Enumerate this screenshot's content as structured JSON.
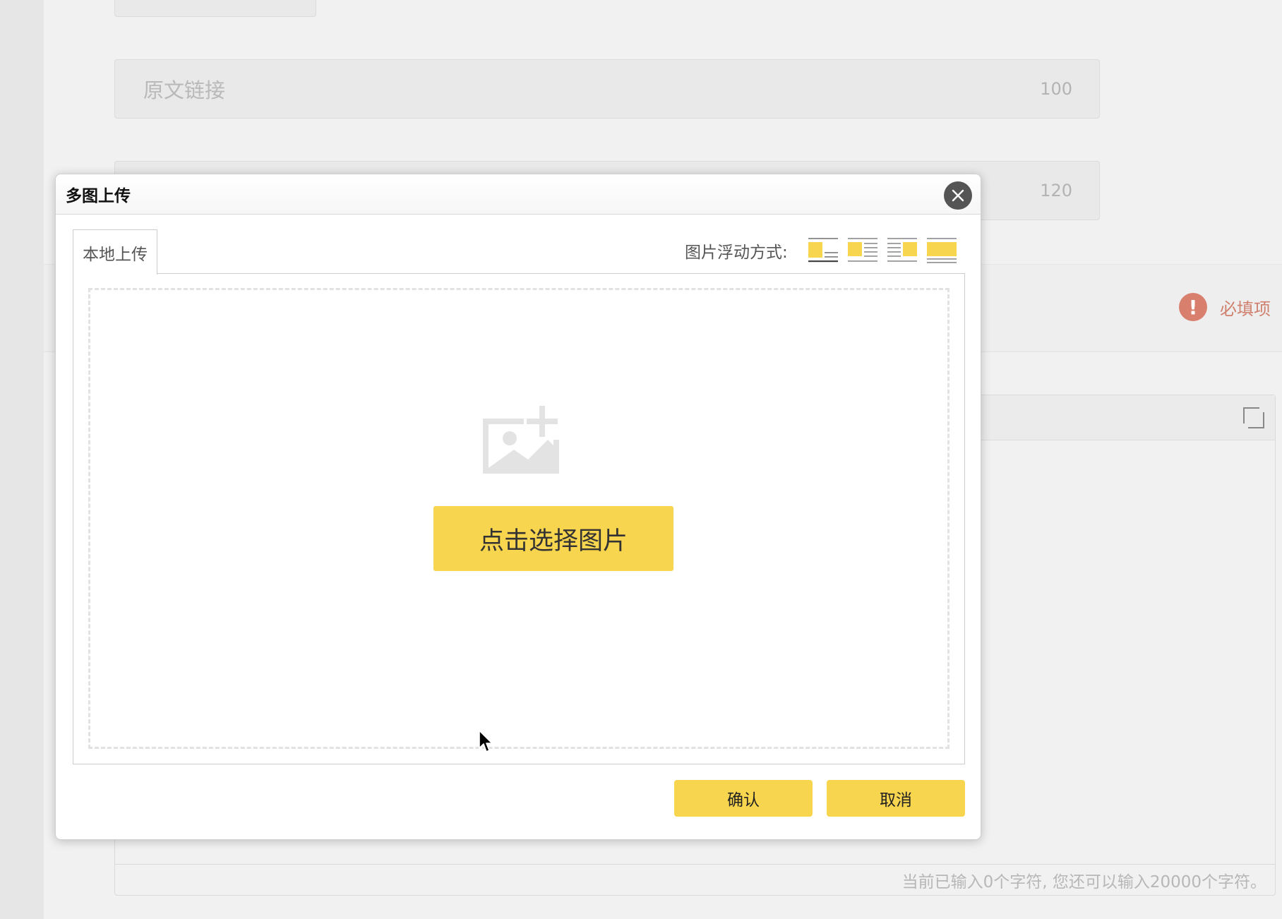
{
  "background": {
    "link_field": {
      "placeholder": "原文链接",
      "counter": "100"
    },
    "second_field": {
      "counter": "120"
    },
    "required_label": "必填项",
    "editor_status": "当前已输入0个字符, 您还可以输入20000个字符。"
  },
  "dialog": {
    "title": "多图上传",
    "tabs": [
      {
        "label": "本地上传",
        "active": true
      }
    ],
    "float_label": "图片浮动方式:",
    "float_options": [
      {
        "icon": "float-none-icon"
      },
      {
        "icon": "float-left-icon"
      },
      {
        "icon": "float-right-icon"
      },
      {
        "icon": "float-center-icon"
      }
    ],
    "pick_button": "点击选择图片",
    "confirm_button": "确认",
    "cancel_button": "取消"
  },
  "colors": {
    "accent": "#f8d54e",
    "close_button": "#555555",
    "required": "#d97f6e",
    "dashed_border": "#e2e2e2"
  }
}
